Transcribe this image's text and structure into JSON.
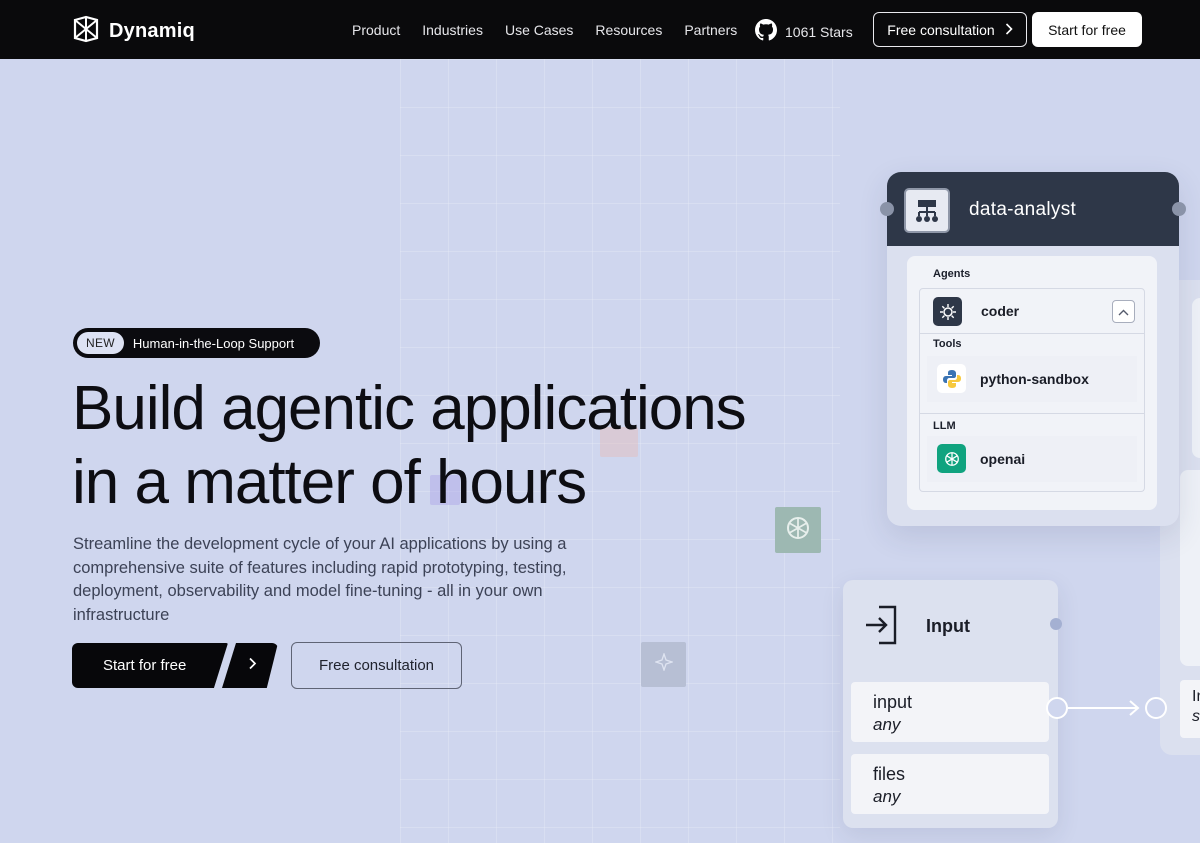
{
  "nav": {
    "brand": "Dynamiq",
    "links": [
      "Product",
      "Industries",
      "Use Cases",
      "Resources",
      "Partners"
    ],
    "github_stars": "1061 Stars",
    "consult_label": "Free consultation",
    "start_label": "Start for free"
  },
  "hero": {
    "badge_new": "NEW",
    "badge_text": "Human-in-the-Loop Support",
    "title_line1": "Build agentic applications",
    "title_line2": "in a matter of hours",
    "subtitle": "Streamline the development cycle of your AI applications by using a comprehensive suite of features including rapid prototyping, testing, deployment, observability and model fine-tuning - all in your own infrastructure",
    "start_label": "Start for free",
    "consult_label": "Free consultation"
  },
  "workflow": {
    "agent_node": {
      "title": "data-analyst",
      "agents_label": "Agents",
      "agent_name": "coder",
      "tools_label": "Tools",
      "tool_name": "python-sandbox",
      "llm_label": "LLM",
      "llm_name": "openai"
    },
    "input_node": {
      "title": "Input",
      "fields": [
        {
          "name": "input",
          "type": "any"
        },
        {
          "name": "files",
          "type": "any"
        }
      ]
    },
    "edge_partial": [
      "In",
      "s"
    ]
  },
  "colors": {
    "background": "#cfd6ee",
    "nav_bg": "#0a0a0c",
    "card_header": "#2e3748",
    "openai_green": "#10a37f"
  }
}
